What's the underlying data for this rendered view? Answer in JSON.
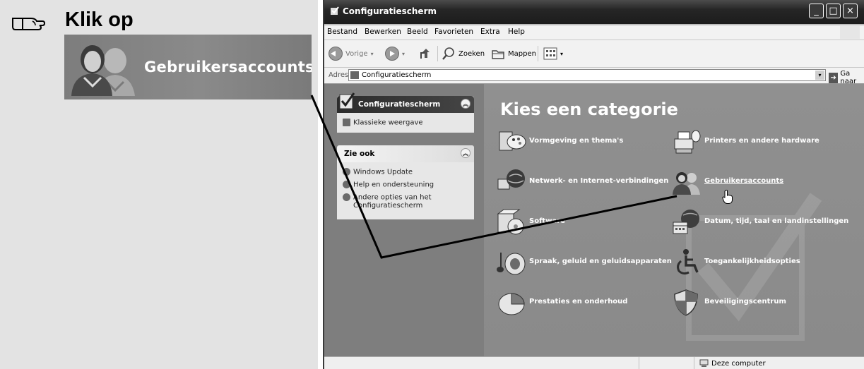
{
  "instruction": {
    "title": "Klik op",
    "zoom_label": "Gebruikersaccounts"
  },
  "window": {
    "title": "Configuratiescherm",
    "menu": [
      "Bestand",
      "Bewerken",
      "Beeld",
      "Favorieten",
      "Extra",
      "Help"
    ],
    "toolbar": {
      "back": "Vorige",
      "search": "Zoeken",
      "folders": "Mappen"
    },
    "address": {
      "label": "Adres",
      "value": "Configuratiescherm",
      "go": "Ga naar"
    },
    "controls": {
      "minimize": "_",
      "maximize": "□",
      "close": "×"
    }
  },
  "taskpane": {
    "panel": {
      "title": "Configuratiescherm",
      "item": "Klassieke weergave"
    },
    "see_also": {
      "title": "Zie ook",
      "items": [
        "Windows Update",
        "Help en ondersteuning",
        "Andere opties van het",
        "Configuratiescherm"
      ]
    }
  },
  "content": {
    "heading": "Kies een categorie",
    "categories": [
      "Vormgeving en thema's",
      "Printers en andere hardware",
      "Netwerk- en Internet-verbindingen",
      "Gebruikersaccounts",
      "Software",
      "Datum, tijd, taal en landinstellingen",
      "Spraak, geluid en geluidsapparaten",
      "Toegankelijkheidsopties",
      "Prestaties en onderhoud",
      "Beveiligingscentrum"
    ]
  },
  "statusbar": {
    "text": "Deze computer"
  },
  "colors": {
    "taskpane_bg": "#7e7e7e",
    "content_bg": "#8e8e8e",
    "titlebar": "#262626"
  },
  "icons": {
    "instruction": "pointing-hand-icon",
    "users": "users-icon",
    "cursor": "hand-cursor-icon"
  }
}
